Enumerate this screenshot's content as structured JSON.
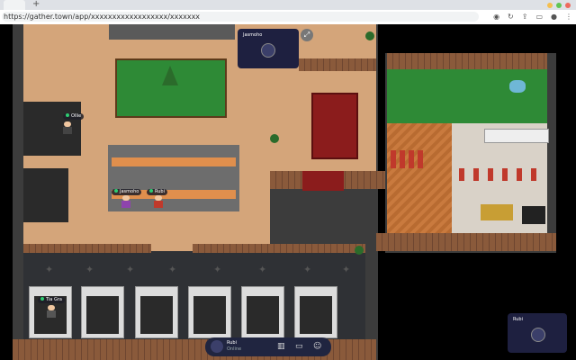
{
  "browser": {
    "url": "https://gather.town/app/xxxxxxxxxxxxxxxxxx/xxxxxxx",
    "new_tab_glyph": "+"
  },
  "participants": [
    {
      "name": "Jasmoho",
      "status": "online"
    },
    {
      "name": "Ollie",
      "status": "online"
    },
    {
      "name": "Rubi",
      "status": "online"
    },
    {
      "name": "Tia Gra",
      "status": "online"
    }
  ],
  "video_tiles": {
    "top_label": "Jasmoho",
    "bottom_label": "Rubi"
  },
  "bottom_bar": {
    "user_name": "Rubi",
    "user_status": "Online",
    "icons": [
      "map-icon",
      "screen-share-icon",
      "emoji-icon"
    ]
  },
  "colors": {
    "accent": "#202540",
    "floor": "#d4a57a",
    "online": "#2ecc71"
  }
}
